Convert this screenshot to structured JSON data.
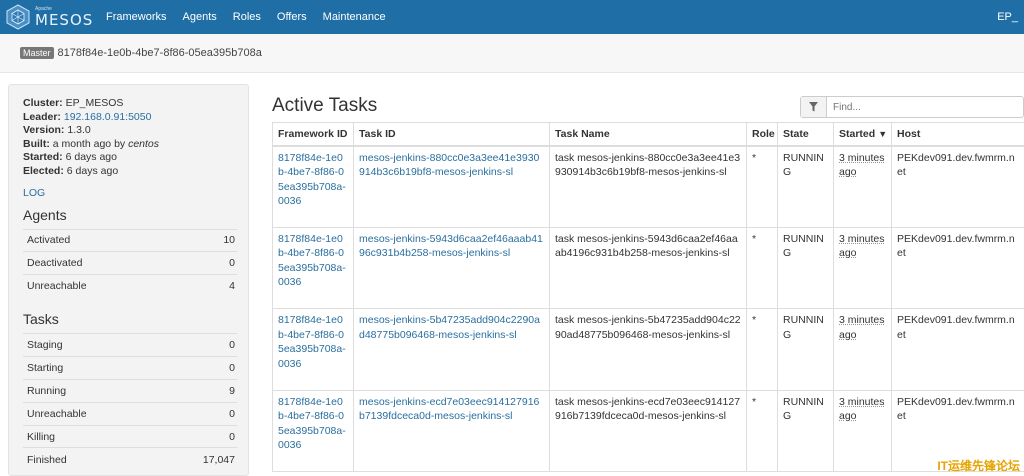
{
  "nav": {
    "brand_apache": "Apache",
    "brand_name": "MESOS",
    "items": [
      "Frameworks",
      "Agents",
      "Roles",
      "Offers",
      "Maintenance"
    ],
    "right": "EP_"
  },
  "master": {
    "badge": "Master",
    "id": "8178f84e-1e0b-4be7-8f86-05ea395b708a"
  },
  "sidebar": {
    "cluster_label": "Cluster:",
    "cluster": "EP_MESOS",
    "leader_label": "Leader:",
    "leader": "192.168.0.91:5050",
    "version_label": "Version:",
    "version": "1.3.0",
    "built_label": "Built:",
    "built_time": "a month ago",
    "built_by": "by",
    "built_user": "centos",
    "started_label": "Started:",
    "started": "6 days ago",
    "elected_label": "Elected:",
    "elected": "6 days ago",
    "log": "LOG",
    "agents_title": "Agents",
    "agents": [
      {
        "label": "Activated",
        "value": "10"
      },
      {
        "label": "Deactivated",
        "value": "0"
      },
      {
        "label": "Unreachable",
        "value": "4"
      }
    ],
    "tasks_title": "Tasks",
    "tasks": [
      {
        "label": "Staging",
        "value": "0"
      },
      {
        "label": "Starting",
        "value": "0"
      },
      {
        "label": "Running",
        "value": "9"
      },
      {
        "label": "Unreachable",
        "value": "0"
      },
      {
        "label": "Killing",
        "value": "0"
      },
      {
        "label": "Finished",
        "value": "17,047"
      }
    ]
  },
  "main": {
    "title": "Active Tasks",
    "filter_placeholder": "Find...",
    "columns": [
      "Framework ID",
      "Task ID",
      "Task Name",
      "Role",
      "State",
      "Started",
      "Host"
    ],
    "sort_arrow": "▼",
    "rows": [
      {
        "framework_id": "8178f84e-1e0b-4be7-8f86-05ea395b708a-0036",
        "task_id": "mesos-jenkins-880cc0e3a3ee41e3930914b3c6b19bf8-mesos-jenkins-sl",
        "task_name": "task mesos-jenkins-880cc0e3a3ee41e3930914b3c6b19bf8-mesos-jenkins-sl",
        "role": "*",
        "state": "RUNNING",
        "started": "3 minutes ago",
        "host": "PEKdev091.dev.fwmrm.net"
      },
      {
        "framework_id": "8178f84e-1e0b-4be7-8f86-05ea395b708a-0036",
        "task_id": "mesos-jenkins-5943d6caa2ef46aaab4196c931b4b258-mesos-jenkins-sl",
        "task_name": "task mesos-jenkins-5943d6caa2ef46aaab4196c931b4b258-mesos-jenkins-sl",
        "role": "*",
        "state": "RUNNING",
        "started": "3 minutes ago",
        "host": "PEKdev091.dev.fwmrm.net"
      },
      {
        "framework_id": "8178f84e-1e0b-4be7-8f86-05ea395b708a-0036",
        "task_id": "mesos-jenkins-5b47235add904c2290ad48775b096468-mesos-jenkins-sl",
        "task_name": "task mesos-jenkins-5b47235add904c2290ad48775b096468-mesos-jenkins-sl",
        "role": "*",
        "state": "RUNNING",
        "started": "3 minutes ago",
        "host": "PEKdev091.dev.fwmrm.net"
      },
      {
        "framework_id": "8178f84e-1e0b-4be7-8f86-05ea395b708a-0036",
        "task_id": "mesos-jenkins-ecd7e03eec914127916b7139fdceca0d-mesos-jenkins-sl",
        "task_name": "task mesos-jenkins-ecd7e03eec914127916b7139fdceca0d-mesos-jenkins-sl",
        "role": "*",
        "state": "RUNNING",
        "started": "3 minutes ago",
        "host": "PEKdev091.dev.fwmrm.net"
      }
    ]
  },
  "watermark": "IT运维先锋论坛",
  "colors": {
    "navbar": "#1f6fa6",
    "link": "#2a6f9e",
    "sidebar_bg": "#f3f3f3"
  },
  "icons": {
    "logo": "mesos-cube-logo-icon",
    "filter": "filter-funnel-icon"
  }
}
